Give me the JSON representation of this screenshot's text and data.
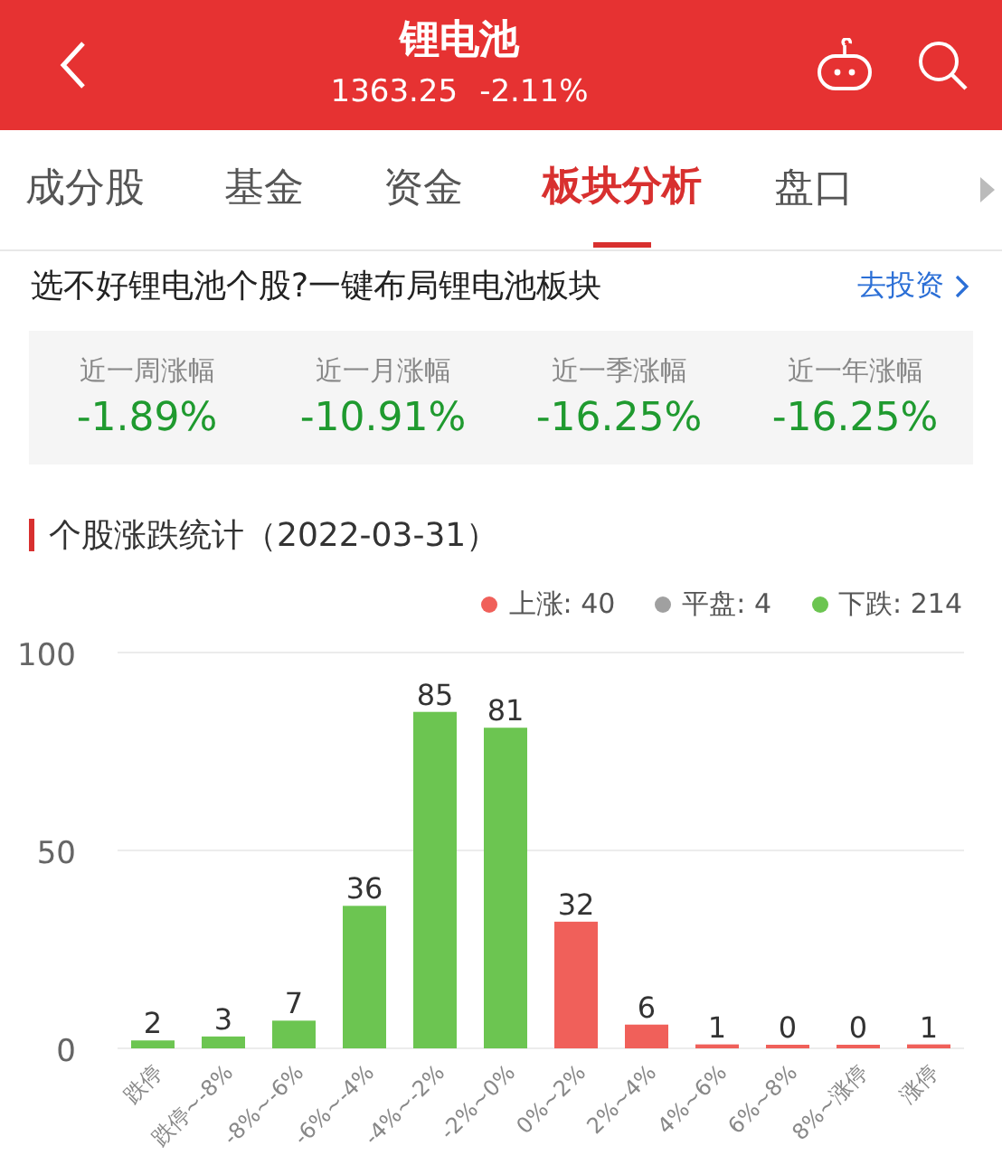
{
  "header": {
    "title": "锂电池",
    "price": "1363.25",
    "change": "-2.11%"
  },
  "tabs": [
    {
      "label": "成分股",
      "selected": false
    },
    {
      "label": "基金",
      "selected": false
    },
    {
      "label": "资金",
      "selected": false
    },
    {
      "label": "板块分析",
      "selected": true
    },
    {
      "label": "盘口",
      "selected": false
    }
  ],
  "promo": {
    "text": "选不好锂电池个股?一键布局锂电池板块",
    "link": "去投资"
  },
  "stats": [
    {
      "label": "近一周涨幅",
      "value": "-1.89%"
    },
    {
      "label": "近一月涨幅",
      "value": "-10.91%"
    },
    {
      "label": "近一季涨幅",
      "value": "-16.25%"
    },
    {
      "label": "近一年涨幅",
      "value": "-16.25%"
    }
  ],
  "section": {
    "title": "个股涨跌统计（2022-03-31）"
  },
  "chart_data": {
    "type": "bar",
    "categories": [
      "跌停",
      "跌停~-8%",
      "-8%~-6%",
      "-6%~-4%",
      "-4%~-2%",
      "-2%~0%",
      "0%~2%",
      "2%~4%",
      "4%~6%",
      "6%~8%",
      "8%~涨停",
      "涨停"
    ],
    "series": [
      {
        "name": "上涨: 40",
        "color": "#f0605a",
        "values": [
          null,
          null,
          null,
          null,
          null,
          null,
          32,
          6,
          1,
          0,
          0,
          1
        ]
      },
      {
        "name": "平盘: 4",
        "color": "#a0a0a0",
        "values": [
          null,
          null,
          null,
          null,
          null,
          null,
          null,
          null,
          null,
          null,
          null,
          null
        ]
      },
      {
        "name": "下跌: 214",
        "color": "#6cc551",
        "values": [
          2,
          3,
          7,
          36,
          85,
          81,
          null,
          null,
          null,
          null,
          null,
          null
        ]
      }
    ],
    "ylim": [
      0,
      100
    ],
    "yticks": [
      0,
      50,
      100
    ],
    "stacked": true,
    "data_labels": true
  }
}
